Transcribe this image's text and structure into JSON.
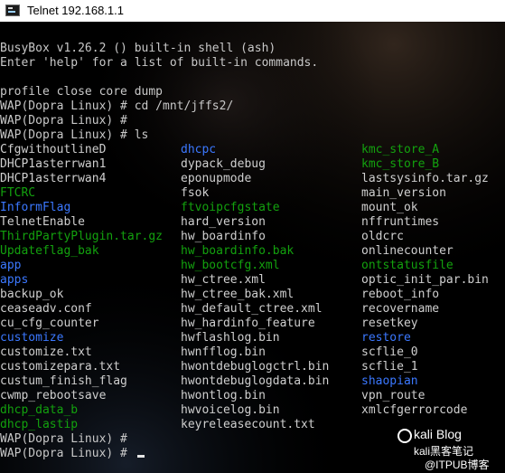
{
  "window": {
    "title": "Telnet 192.168.1.1"
  },
  "terminal": {
    "header_lines": [
      "BusyBox v1.26.2 () built-in shell (ash)",
      "Enter 'help' for a list of built-in commands.",
      "",
      "profile close core dump",
      "WAP(Dopra Linux) # cd /mnt/jffs2/",
      "WAP(Dopra Linux) #",
      "WAP(Dopra Linux) # ls"
    ],
    "listing": [
      [
        {
          "t": "CfgwithoutlineD",
          "c": "white"
        },
        {
          "t": "dhcpc",
          "c": "blue"
        },
        {
          "t": "kmc_store_A",
          "c": "green"
        }
      ],
      [
        {
          "t": "DHCP1asterrwan1",
          "c": "white"
        },
        {
          "t": "dypack_debug",
          "c": "white"
        },
        {
          "t": "kmc_store_B",
          "c": "green"
        }
      ],
      [
        {
          "t": "DHCP1asterrwan4",
          "c": "white"
        },
        {
          "t": "eponupmode",
          "c": "white"
        },
        {
          "t": "lastsysinfo.tar.gz",
          "c": "white"
        }
      ],
      [
        {
          "t": "FTCRC",
          "c": "green"
        },
        {
          "t": "fsok",
          "c": "white"
        },
        {
          "t": "main_version",
          "c": "white"
        }
      ],
      [
        {
          "t": "InformFlag",
          "c": "blue"
        },
        {
          "t": "ftvoipcfgstate",
          "c": "green"
        },
        {
          "t": "mount_ok",
          "c": "white"
        }
      ],
      [
        {
          "t": "TelnetEnable",
          "c": "white"
        },
        {
          "t": "hard_version",
          "c": "white"
        },
        {
          "t": "nffruntimes",
          "c": "white"
        }
      ],
      [
        {
          "t": "ThirdPartyPlugin.tar.gz",
          "c": "green"
        },
        {
          "t": "hw_boardinfo",
          "c": "white"
        },
        {
          "t": "oldcrc",
          "c": "white"
        }
      ],
      [
        {
          "t": "Updateflag_bak",
          "c": "green"
        },
        {
          "t": "hw_boardinfo.bak",
          "c": "green"
        },
        {
          "t": "onlinecounter",
          "c": "white"
        }
      ],
      [
        {
          "t": "app",
          "c": "blue"
        },
        {
          "t": "hw_bootcfg.xml",
          "c": "green"
        },
        {
          "t": "ontstatusfile",
          "c": "green"
        }
      ],
      [
        {
          "t": "apps",
          "c": "blue"
        },
        {
          "t": "hw_ctree.xml",
          "c": "white"
        },
        {
          "t": "optic_init_par.bin",
          "c": "white"
        }
      ],
      [
        {
          "t": "backup_ok",
          "c": "white"
        },
        {
          "t": "hw_ctree_bak.xml",
          "c": "white"
        },
        {
          "t": "reboot_info",
          "c": "white"
        }
      ],
      [
        {
          "t": "ceaseadv.conf",
          "c": "white"
        },
        {
          "t": "hw_default_ctree.xml",
          "c": "white"
        },
        {
          "t": "recovername",
          "c": "white"
        }
      ],
      [
        {
          "t": "cu_cfg_counter",
          "c": "white"
        },
        {
          "t": "hw_hardinfo_feature",
          "c": "white"
        },
        {
          "t": "resetkey",
          "c": "white"
        }
      ],
      [
        {
          "t": "customize",
          "c": "blue"
        },
        {
          "t": "hwflashlog.bin",
          "c": "white"
        },
        {
          "t": "restore",
          "c": "blue"
        }
      ],
      [
        {
          "t": "customize.txt",
          "c": "white"
        },
        {
          "t": "hwnfflog.bin",
          "c": "white"
        },
        {
          "t": "scflie_0",
          "c": "white"
        }
      ],
      [
        {
          "t": "customizepara.txt",
          "c": "white"
        },
        {
          "t": "hwontdebuglogctrl.bin",
          "c": "white"
        },
        {
          "t": "scflie_1",
          "c": "white"
        }
      ],
      [
        {
          "t": "custum_finish_flag",
          "c": "white"
        },
        {
          "t": "hwontdebuglogdata.bin",
          "c": "white"
        },
        {
          "t": "shaopian",
          "c": "blue"
        }
      ],
      [
        {
          "t": "cwmp_rebootsave",
          "c": "white"
        },
        {
          "t": "hwontlog.bin",
          "c": "white"
        },
        {
          "t": "vpn_route",
          "c": "white"
        }
      ],
      [
        {
          "t": "dhcp_data_b",
          "c": "green"
        },
        {
          "t": "hwvoicelog.bin",
          "c": "white"
        },
        {
          "t": "xmlcfgerrorcode",
          "c": "white"
        }
      ],
      [
        {
          "t": "dhcp_lastip",
          "c": "green"
        },
        {
          "t": "keyreleasecount.txt",
          "c": "white"
        },
        {
          "t": "",
          "c": "white"
        }
      ]
    ],
    "footer_lines": [
      "WAP(Dopra Linux) #",
      "WAP(Dopra Linux) #"
    ]
  },
  "watermark": {
    "line1": "kali Blog",
    "line2": "kali黑客笔记",
    "line3": "@ITPUB博客"
  },
  "colors": {
    "white": "#cfcfcf",
    "blue": "#3b78ff",
    "green": "#13a10e",
    "background": "#000000"
  }
}
